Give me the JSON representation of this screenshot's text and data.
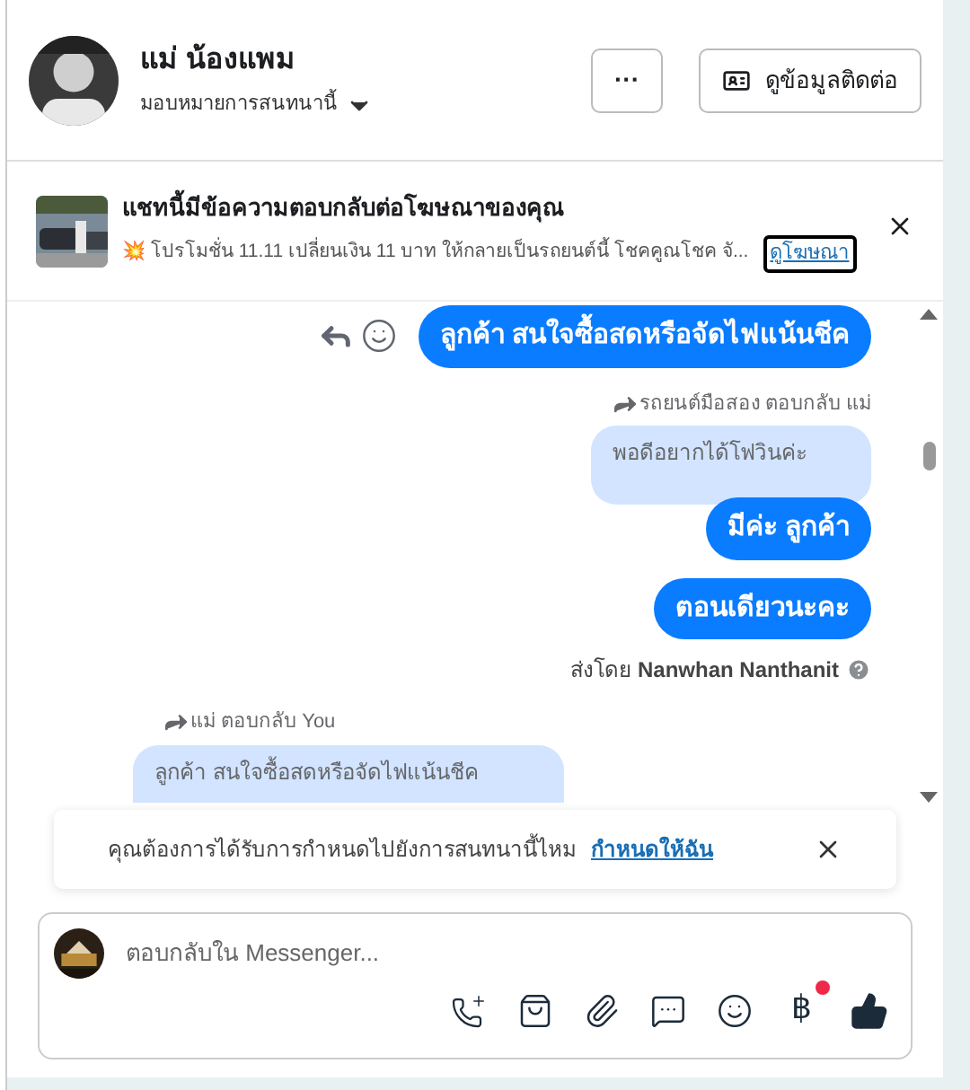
{
  "header": {
    "name": "แม่ น้องแพม",
    "assign_label": "มอบหมายการสนทนานี้",
    "more_button": "···",
    "contact_button": "ดูข้อมูลติดต่อ"
  },
  "ad_banner": {
    "title": "แชทนี้มีข้อความตอบกลับต่อโฆษณาของคุณ",
    "text": "💥 โปรโมชั่น 11.11 เปลี่ยนเงิน 11 บาท ให้กลายเป็นรถยนต์นี้ โชคคูณโชค จั...",
    "link": "ดูโฆษณา"
  },
  "messages": [
    {
      "kind": "sent",
      "text": "ลูกค้า สนใจซื้อสดหรือจัดไฟแน้นชีค",
      "actions": true
    },
    {
      "kind": "sent_reply_label",
      "text": "รถยนต์มือสอง ตอบกลับ แม่"
    },
    {
      "kind": "sent_quote",
      "text": "พอดีอยากได้โฟวินค่ะ"
    },
    {
      "kind": "sent",
      "text": "มีค่ะ  ลูกค้า"
    },
    {
      "kind": "sent",
      "text": "ตอนเดียวนะคะ"
    },
    {
      "kind": "sender",
      "text": "ส่งโดย **Nanwhan Nanthanit**"
    },
    {
      "kind": "received_reply_label",
      "text": "แม่ ตอบกลับ You"
    },
    {
      "kind": "received_quote",
      "text": "ลูกค้า สนใจซื้อสดหรือจัดไฟแน้นชีค"
    }
  ],
  "notice": {
    "text": "คุณต้องการได้รับการกำหนดไปยังการสนทนานี้ไหม",
    "link": "กำหนดให้ฉัน"
  },
  "composer": {
    "placeholder": "ตอบกลับใน Messenger...",
    "currency_symbol": "฿",
    "currency_badge": true
  }
}
